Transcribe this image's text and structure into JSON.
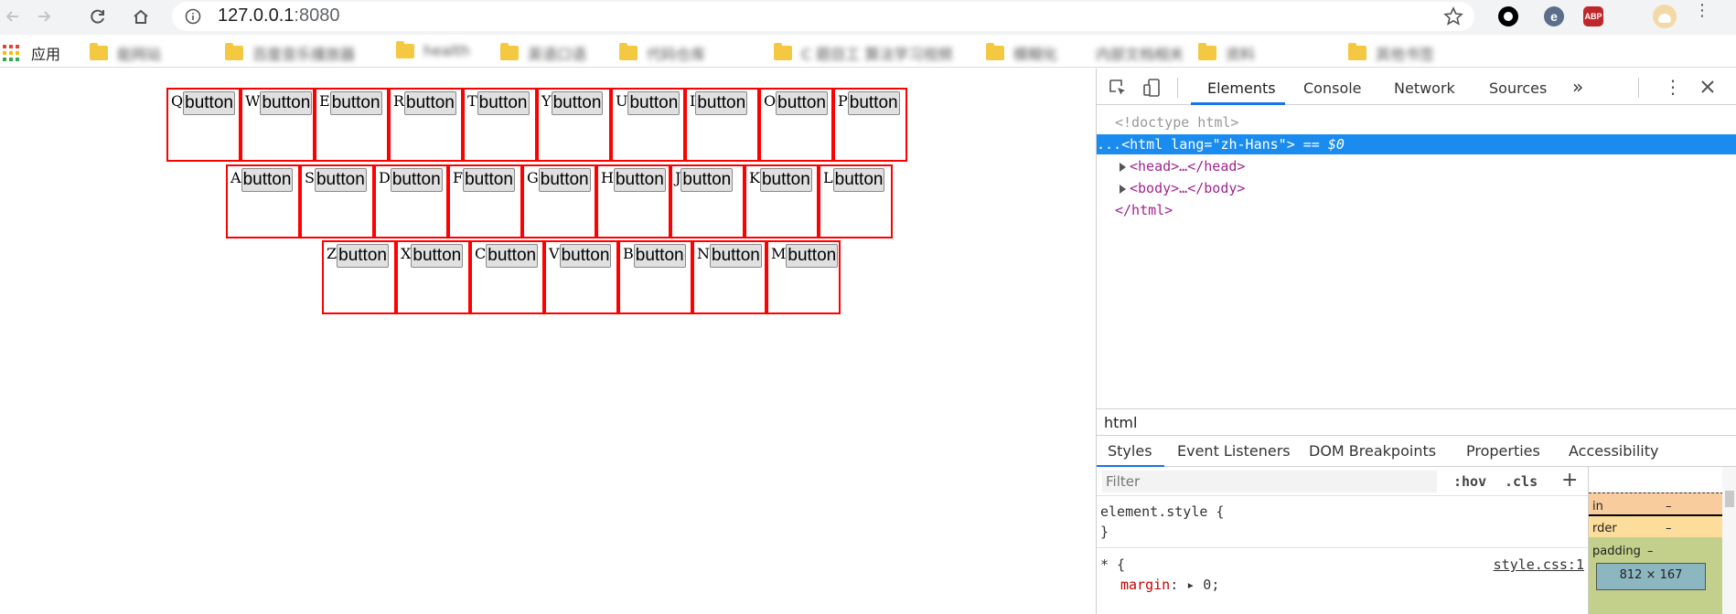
{
  "browser": {
    "url_host": "127.0.0.1",
    "url_port": ":8080",
    "extensions": [
      "circle-extension-icon",
      "e-extension-icon",
      "abp-icon",
      "profile-avatar"
    ],
    "abp_label": "ABP"
  },
  "bookmarks": {
    "apps_label": "应用",
    "items": [
      "能网站",
      "百度音乐播放器",
      "health",
      "英语口语",
      "代码仓库",
      "C 题目工 算法学习视频",
      "模糊化",
      "内部文档相关",
      "资料",
      "其他书签"
    ]
  },
  "page": {
    "rows": [
      {
        "letters": [
          "Q",
          "W",
          "E",
          "R",
          "T",
          "Y",
          "U",
          "I",
          "O",
          "P"
        ]
      },
      {
        "letters": [
          "A",
          "S",
          "D",
          "F",
          "G",
          "H",
          "J",
          "K",
          "L"
        ]
      },
      {
        "letters": [
          "Z",
          "X",
          "C",
          "V",
          "B",
          "N",
          "M"
        ]
      }
    ],
    "button_label": "button"
  },
  "devtools": {
    "tabs": [
      "Elements",
      "Console",
      "Network",
      "Sources"
    ],
    "more": "»",
    "dom": {
      "doctype": "<!doctype html>",
      "html_open_tag": "<html",
      "html_attr_name": "lang",
      "html_attr_value": "\"zh-Hans\"",
      "html_close_bracket": ">",
      "selected_marker": "== $0",
      "ellipsis": "...",
      "head": "<head>…</head>",
      "body": "<body>…</body>",
      "html_close": "</html>"
    },
    "breadcrumb": "html",
    "sub_tabs": [
      "Styles",
      "Event Listeners",
      "DOM Breakpoints",
      "Properties",
      "Accessibility"
    ],
    "filter_placeholder": "Filter",
    "hov": ":hov",
    "cls": ".cls",
    "plus": "+",
    "rules": {
      "element_style_open": "element.style {",
      "element_style_close": "}",
      "star_selector": "* {",
      "margin_prop": "margin",
      "margin_value": ": ▸ 0;",
      "source_link": "style.css:1"
    },
    "box_model": {
      "margin_label": "in",
      "margin_value": "–",
      "border_label": "rder",
      "border_value": "–",
      "padding_label": "padding",
      "padding_value": "–",
      "content_size": "812 × 167"
    }
  }
}
